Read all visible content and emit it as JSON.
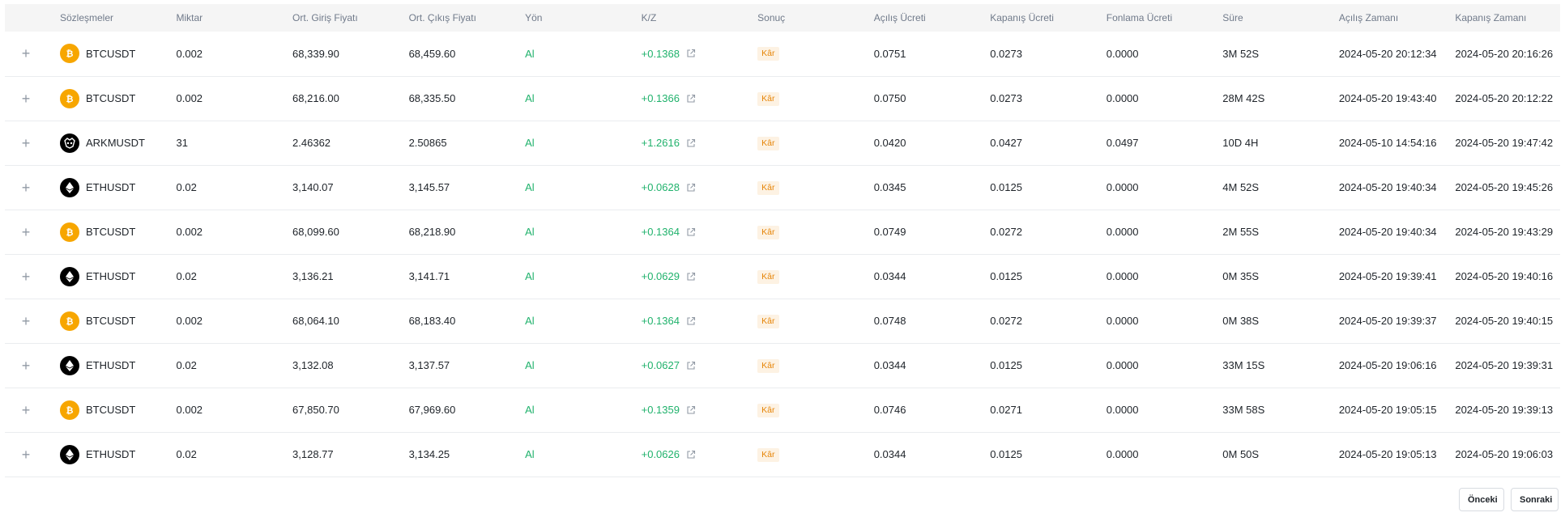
{
  "columns": [
    "Sözleşmeler",
    "Miktar",
    "Ort. Giriş Fiyatı",
    "Ort. Çıkış Fiyatı",
    "Yön",
    "K/Z",
    "Sonuç",
    "Açılış Ücreti",
    "Kapanış Ücreti",
    "Fonlama Ücreti",
    "Süre",
    "Açılış Zamanı",
    "Kapanış Zamanı"
  ],
  "rows": [
    {
      "symbol": "BTCUSDT",
      "coin": "btc-icon",
      "qty": "0.002",
      "entry": "68,339.90",
      "exit": "68,459.60",
      "direction": "Al",
      "pnl": "+0.1368",
      "result": "Kâr",
      "open_fee": "0.0751",
      "close_fee": "0.0273",
      "funding_fee": "0.0000",
      "duration": "3M 52S",
      "open_time": "2024-05-20 20:12:34",
      "close_time": "2024-05-20 20:16:26"
    },
    {
      "symbol": "BTCUSDT",
      "coin": "btc-icon",
      "qty": "0.002",
      "entry": "68,216.00",
      "exit": "68,335.50",
      "direction": "Al",
      "pnl": "+0.1366",
      "result": "Kâr",
      "open_fee": "0.0750",
      "close_fee": "0.0273",
      "funding_fee": "0.0000",
      "duration": "28M 42S",
      "open_time": "2024-05-20 19:43:40",
      "close_time": "2024-05-20 20:12:22"
    },
    {
      "symbol": "ARKMUSDT",
      "coin": "arkm-icon",
      "qty": "31",
      "entry": "2.46362",
      "exit": "2.50865",
      "direction": "Al",
      "pnl": "+1.2616",
      "result": "Kâr",
      "open_fee": "0.0420",
      "close_fee": "0.0427",
      "funding_fee": "0.0497",
      "duration": "10D 4H",
      "open_time": "2024-05-10 14:54:16",
      "close_time": "2024-05-20 19:47:42"
    },
    {
      "symbol": "ETHUSDT",
      "coin": "eth-icon",
      "qty": "0.02",
      "entry": "3,140.07",
      "exit": "3,145.57",
      "direction": "Al",
      "pnl": "+0.0628",
      "result": "Kâr",
      "open_fee": "0.0345",
      "close_fee": "0.0125",
      "funding_fee": "0.0000",
      "duration": "4M 52S",
      "open_time": "2024-05-20 19:40:34",
      "close_time": "2024-05-20 19:45:26"
    },
    {
      "symbol": "BTCUSDT",
      "coin": "btc-icon",
      "qty": "0.002",
      "entry": "68,099.60",
      "exit": "68,218.90",
      "direction": "Al",
      "pnl": "+0.1364",
      "result": "Kâr",
      "open_fee": "0.0749",
      "close_fee": "0.0272",
      "funding_fee": "0.0000",
      "duration": "2M 55S",
      "open_time": "2024-05-20 19:40:34",
      "close_time": "2024-05-20 19:43:29"
    },
    {
      "symbol": "ETHUSDT",
      "coin": "eth-icon",
      "qty": "0.02",
      "entry": "3,136.21",
      "exit": "3,141.71",
      "direction": "Al",
      "pnl": "+0.0629",
      "result": "Kâr",
      "open_fee": "0.0344",
      "close_fee": "0.0125",
      "funding_fee": "0.0000",
      "duration": "0M 35S",
      "open_time": "2024-05-20 19:39:41",
      "close_time": "2024-05-20 19:40:16"
    },
    {
      "symbol": "BTCUSDT",
      "coin": "btc-icon",
      "qty": "0.002",
      "entry": "68,064.10",
      "exit": "68,183.40",
      "direction": "Al",
      "pnl": "+0.1364",
      "result": "Kâr",
      "open_fee": "0.0748",
      "close_fee": "0.0272",
      "funding_fee": "0.0000",
      "duration": "0M 38S",
      "open_time": "2024-05-20 19:39:37",
      "close_time": "2024-05-20 19:40:15"
    },
    {
      "symbol": "ETHUSDT",
      "coin": "eth-icon",
      "qty": "0.02",
      "entry": "3,132.08",
      "exit": "3,137.57",
      "direction": "Al",
      "pnl": "+0.0627",
      "result": "Kâr",
      "open_fee": "0.0344",
      "close_fee": "0.0125",
      "funding_fee": "0.0000",
      "duration": "33M 15S",
      "open_time": "2024-05-20 19:06:16",
      "close_time": "2024-05-20 19:39:31"
    },
    {
      "symbol": "BTCUSDT",
      "coin": "btc-icon",
      "qty": "0.002",
      "entry": "67,850.70",
      "exit": "67,969.60",
      "direction": "Al",
      "pnl": "+0.1359",
      "result": "Kâr",
      "open_fee": "0.0746",
      "close_fee": "0.0271",
      "funding_fee": "0.0000",
      "duration": "33M 58S",
      "open_time": "2024-05-20 19:05:15",
      "close_time": "2024-05-20 19:39:13"
    },
    {
      "symbol": "ETHUSDT",
      "coin": "eth-icon",
      "qty": "0.02",
      "entry": "3,128.77",
      "exit": "3,134.25",
      "direction": "Al",
      "pnl": "+0.0626",
      "result": "Kâr",
      "open_fee": "0.0344",
      "close_fee": "0.0125",
      "funding_fee": "0.0000",
      "duration": "0M 50S",
      "open_time": "2024-05-20 19:05:13",
      "close_time": "2024-05-20 19:06:03"
    }
  ],
  "pagination": {
    "prev_label": "Önceki",
    "next_label": "Sonraki"
  },
  "colors": {
    "positive": "#20b26c",
    "badge_bg": "#fdf2e3",
    "badge_text": "#e6860a",
    "btc": "#f7a600",
    "header_bg": "#f5f5f5"
  },
  "icons": {
    "expand": "plus-icon",
    "external": "external-link-icon"
  }
}
